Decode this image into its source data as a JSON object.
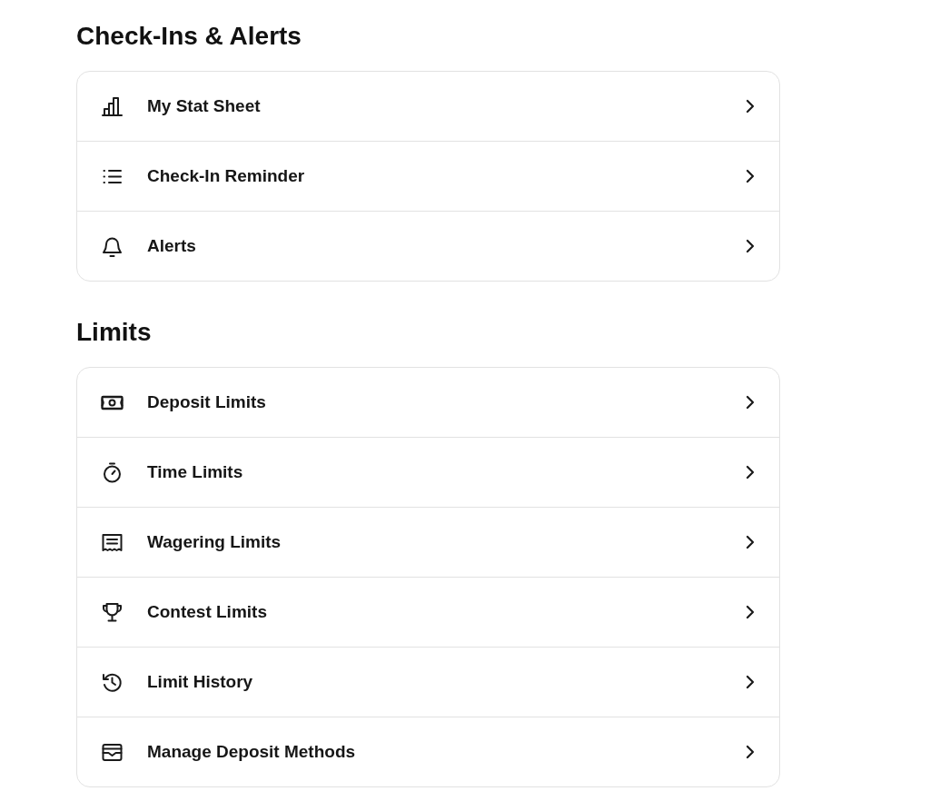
{
  "sections": [
    {
      "title": "Check-Ins & Alerts",
      "items": [
        {
          "label": "My Stat Sheet"
        },
        {
          "label": "Check-In Reminder"
        },
        {
          "label": "Alerts"
        }
      ]
    },
    {
      "title": "Limits",
      "items": [
        {
          "label": "Deposit Limits"
        },
        {
          "label": "Time Limits"
        },
        {
          "label": "Wagering Limits"
        },
        {
          "label": "Contest Limits"
        },
        {
          "label": "Limit History"
        },
        {
          "label": "Manage Deposit Methods"
        }
      ]
    }
  ]
}
